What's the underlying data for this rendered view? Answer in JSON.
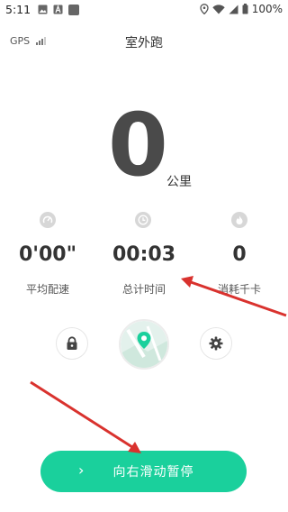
{
  "status_bar": {
    "time": "5:11",
    "battery": "100%",
    "icons": [
      "image-icon",
      "font-icon",
      "app-square-icon",
      "location-icon",
      "wifi-icon",
      "signal-icon",
      "battery-icon"
    ]
  },
  "header": {
    "gps_label": "GPS",
    "title": "室外跑"
  },
  "distance": {
    "value": "0",
    "unit": "公里"
  },
  "stats": [
    {
      "icon": "speedometer-icon",
      "value": "0'00\"",
      "label": "平均配速"
    },
    {
      "icon": "clock-icon",
      "value": "00:03",
      "label": "总计时间"
    },
    {
      "icon": "flame-icon",
      "value": "0",
      "label": "消耗千卡"
    }
  ],
  "controls": {
    "left_icon": "lock-icon",
    "center_icon": "map-icon",
    "right_icon": "gear-icon"
  },
  "slide": {
    "label": "向右滑动暂停",
    "arrow": "›"
  },
  "colors": {
    "accent": "#1ad09c",
    "annotation": "#d9322e",
    "big_number": "#4a4a4a"
  }
}
